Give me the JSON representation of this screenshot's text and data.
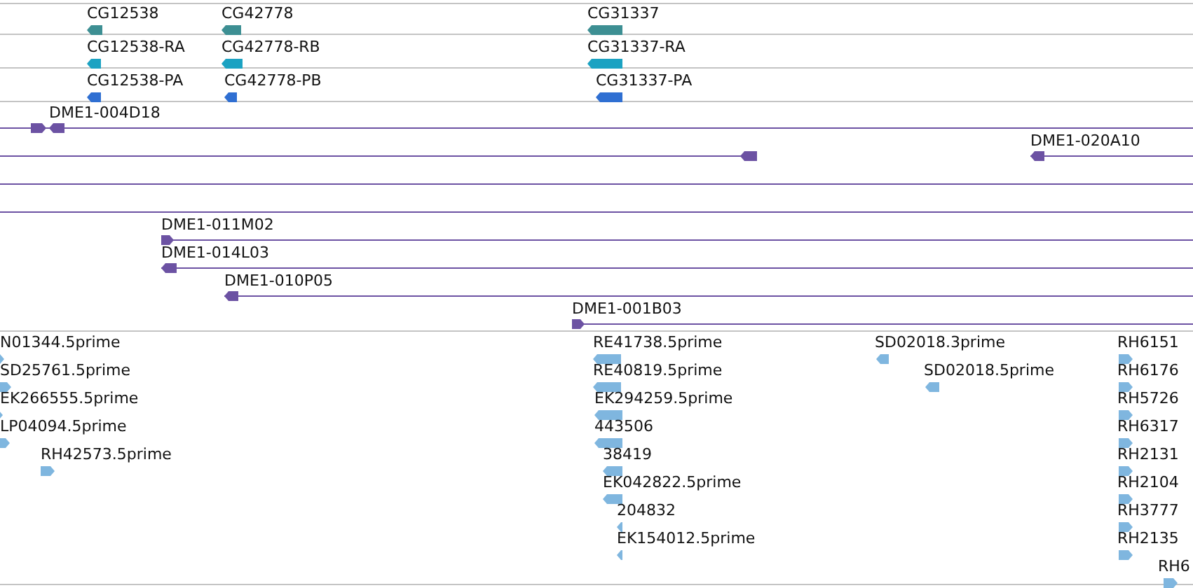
{
  "tracks": [
    {
      "kind": "gene",
      "features": [
        {
          "label": "CG12538",
          "reverse": true
        },
        {
          "label": "CG42778",
          "reverse": true
        },
        {
          "label": "CG31337",
          "reverse": true
        }
      ]
    },
    {
      "kind": "transcript",
      "features": [
        {
          "label": "CG12538-RA",
          "reverse": true
        },
        {
          "label": "CG42778-RB",
          "reverse": true
        },
        {
          "label": "CG31337-RA",
          "reverse": true
        }
      ]
    },
    {
      "kind": "protein",
      "features": [
        {
          "label": "CG12538-PA",
          "reverse": true
        },
        {
          "label": "CG42778-PB",
          "reverse": true
        },
        {
          "label": "CG31337-PA",
          "reverse": true
        }
      ]
    },
    {
      "kind": "clone",
      "features": [
        {
          "label": "DME1-004D18",
          "reverse": true
        },
        {
          "label": "DME1-020A10",
          "reverse": true
        },
        {
          "label": "DME1-011M02",
          "reverse": false
        },
        {
          "label": "DME1-014L03",
          "reverse": true
        },
        {
          "label": "DME1-010P05",
          "reverse": true
        },
        {
          "label": "DME1-001B03",
          "reverse": false
        }
      ]
    },
    {
      "kind": "est",
      "features": [
        {
          "label": "N01344.5prime",
          "reverse": false
        },
        {
          "label": "SD25761.5prime",
          "reverse": false
        },
        {
          "label": "EK266555.5prime",
          "reverse": false
        },
        {
          "label": "LP04094.5prime",
          "reverse": false
        },
        {
          "label": "RH42573.5prime",
          "reverse": false
        },
        {
          "label": "RE41738.5prime",
          "reverse": true
        },
        {
          "label": "RE40819.5prime",
          "reverse": true
        },
        {
          "label": "EK294259.5prime",
          "reverse": true
        },
        {
          "label": "443506",
          "reverse": true
        },
        {
          "label": "38419",
          "reverse": true
        },
        {
          "label": "EK042822.5prime",
          "reverse": true
        },
        {
          "label": "204832",
          "reverse": true
        },
        {
          "label": "EK154012.5prime",
          "reverse": true
        },
        {
          "label": "SD02018.3prime",
          "reverse": true
        },
        {
          "label": "SD02018.5prime",
          "reverse": true
        },
        {
          "label": "RH6151",
          "reverse": false
        },
        {
          "label": "RH6176",
          "reverse": false
        },
        {
          "label": "RH5726",
          "reverse": false
        },
        {
          "label": "RH6317",
          "reverse": false
        },
        {
          "label": "RH2131",
          "reverse": false
        },
        {
          "label": "RH2104",
          "reverse": false
        },
        {
          "label": "RH3777",
          "reverse": false
        },
        {
          "label": "RH2135",
          "reverse": false
        },
        {
          "label": "RH6",
          "reverse": false
        }
      ]
    }
  ]
}
